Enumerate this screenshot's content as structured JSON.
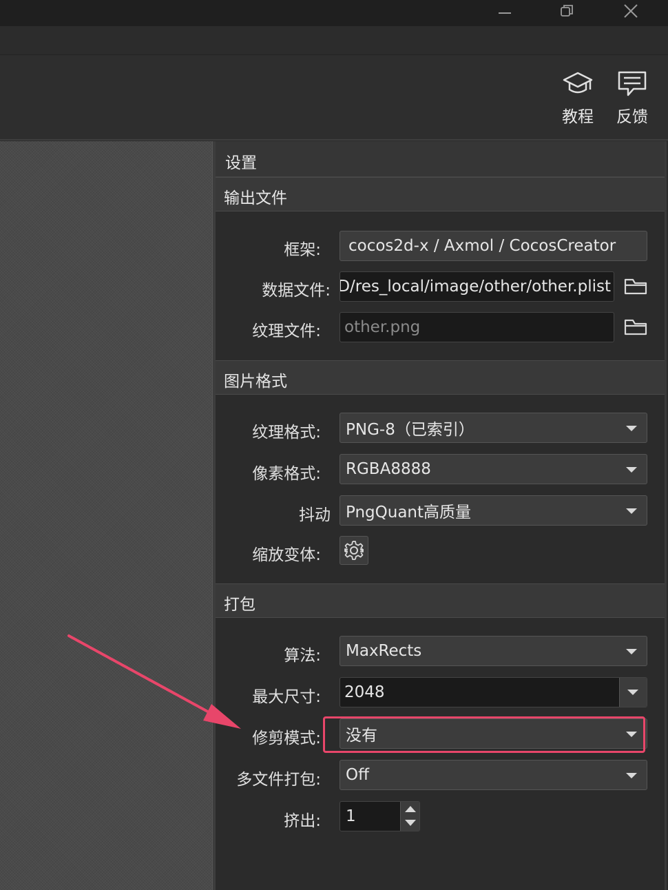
{
  "window": {
    "controls": {
      "minimize": "minimize-icon",
      "restore": "restore-icon",
      "close": "close-icon"
    }
  },
  "toolbar": {
    "tutorial_label": "教程",
    "feedback_label": "反馈",
    "tutorial_icon": "graduation-cap-icon",
    "feedback_icon": "chat-bubble-icon"
  },
  "settings": {
    "title": "设置",
    "output": {
      "header": "输出文件",
      "framework_label": "框架:",
      "framework_value": "cocos2d-x / Axmol / CocosCreator",
      "datafile_label": "数据文件:",
      "datafile_value": "D/res_local/image/other/other.plist",
      "texture_label": "纹理文件:",
      "texture_placeholder": "other.png"
    },
    "image": {
      "header": "图片格式",
      "format_label": "纹理格式:",
      "format_value": "PNG-8（已索引）",
      "pixel_label": "像素格式:",
      "pixel_value": "RGBA8888",
      "dither_label": "抖动",
      "dither_value": "PngQuant高质量",
      "scale_label": "缩放变体:"
    },
    "packing": {
      "header": "打包",
      "algorithm_label": "算法:",
      "algorithm_value": "MaxRects",
      "maxsize_label": "最大尺寸:",
      "maxsize_value": "2048",
      "trim_label": "修剪模式:",
      "trim_value": "没有",
      "multipack_label": "多文件打包:",
      "multipack_value": "Off",
      "extrude_label": "挤出:",
      "extrude_value": "1"
    }
  },
  "colors": {
    "annotation": "#e8466a",
    "panel_bg": "#2b2b2b",
    "field_bg": "#3c3c3c"
  }
}
